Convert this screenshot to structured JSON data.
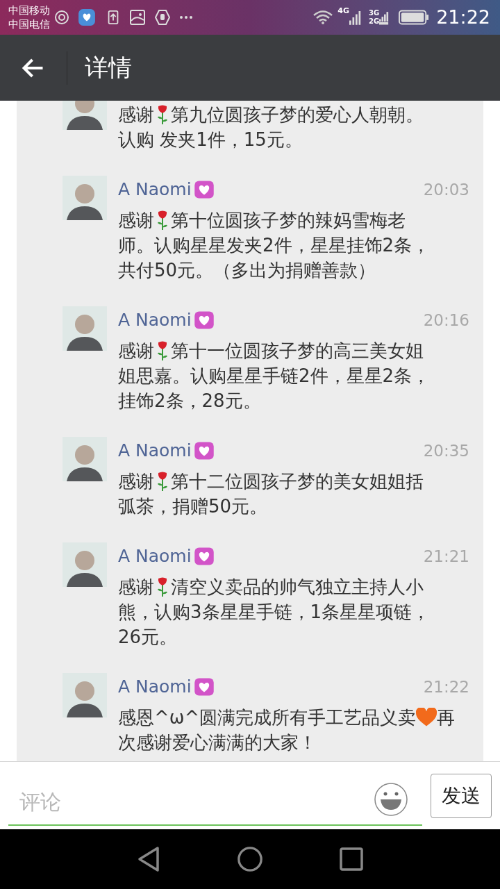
{
  "status_bar": {
    "carriers": [
      "中国移动",
      "中国电信"
    ],
    "network_4g": "4G",
    "network_3g": "3G",
    "network_2g": "2G",
    "time": "21:22"
  },
  "app_bar": {
    "title": "详情"
  },
  "comments": [
    {
      "clipped": true,
      "lines": [
        [
          {
            "kind": "text",
            "text": "感谢"
          },
          {
            "kind": "rose"
          },
          {
            "kind": "text",
            "text": "第九位圆孩子梦的爱心人朝朝。"
          }
        ],
        [
          {
            "kind": "text",
            "text": "认购 发夹1件，15元。"
          }
        ]
      ]
    },
    {
      "clipped": false,
      "name": "A Naomi",
      "time": "20:03",
      "lines": [
        [
          {
            "kind": "text",
            "text": "感谢"
          },
          {
            "kind": "rose"
          },
          {
            "kind": "text",
            "text": "第十位圆孩子梦的辣妈雪梅老"
          }
        ],
        [
          {
            "kind": "text",
            "text": "师。认购星星发夹2件，星星挂饰2条，"
          }
        ],
        [
          {
            "kind": "text",
            "text": "共付50元。（多出为捐赠善款）"
          }
        ]
      ]
    },
    {
      "clipped": false,
      "name": "A Naomi",
      "time": "20:16",
      "lines": [
        [
          {
            "kind": "text",
            "text": "感谢"
          },
          {
            "kind": "rose"
          },
          {
            "kind": "text",
            "text": "第十一位圆孩子梦的高三美女姐"
          }
        ],
        [
          {
            "kind": "text",
            "text": "姐思嘉。认购星星手链2件，星星2条，"
          }
        ],
        [
          {
            "kind": "text",
            "text": "挂饰2条，28元。"
          }
        ]
      ]
    },
    {
      "clipped": false,
      "name": "A Naomi",
      "time": "20:35",
      "lines": [
        [
          {
            "kind": "text",
            "text": "感谢"
          },
          {
            "kind": "rose"
          },
          {
            "kind": "text",
            "text": "第十二位圆孩子梦的美女姐姐括"
          }
        ],
        [
          {
            "kind": "text",
            "text": "弧茶，捐赠50元。"
          }
        ]
      ]
    },
    {
      "clipped": false,
      "name": "A Naomi",
      "time": "21:21",
      "lines": [
        [
          {
            "kind": "text",
            "text": "感谢"
          },
          {
            "kind": "rose"
          },
          {
            "kind": "text",
            "text": "清空义卖品的帅气独立主持人小"
          }
        ],
        [
          {
            "kind": "text",
            "text": "熊，认购3条星星手链，1条星星项链，"
          }
        ],
        [
          {
            "kind": "text",
            "text": "26元。"
          }
        ]
      ]
    },
    {
      "clipped": false,
      "name": "A Naomi",
      "time": "21:22",
      "lines": [
        [
          {
            "kind": "text",
            "text": "感恩^ω^圆满完成所有手工艺品义卖"
          },
          {
            "kind": "heart"
          },
          {
            "kind": "text",
            "text": "再"
          }
        ],
        [
          {
            "kind": "text",
            "text": "次感谢爱心满满的大家！"
          }
        ]
      ]
    }
  ],
  "comment_bar": {
    "placeholder": "评论",
    "send": "发送"
  }
}
